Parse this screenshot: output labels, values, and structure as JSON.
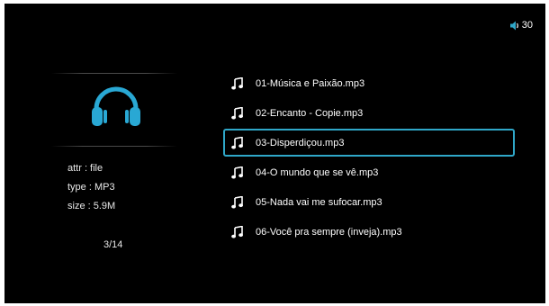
{
  "volume": {
    "icon": "speaker-icon",
    "level": "30"
  },
  "info": {
    "icon": "headphones-icon",
    "accent_color": "#29a8d4",
    "attr": "attr : file",
    "type": "type : MP3",
    "size": "size : 5.9M"
  },
  "page_indicator": "3/14",
  "playlist": {
    "selection_color": "#2fa7c8",
    "items": [
      {
        "icon": "music-note-icon",
        "label": "01-Música e Paixão.mp3"
      },
      {
        "icon": "music-note-icon",
        "label": "02-Encanto - Copie.mp3"
      },
      {
        "icon": "music-note-icon",
        "label": "03-Disperdiçou.mp3",
        "selected": true
      },
      {
        "icon": "music-note-icon",
        "label": "04-O mundo que se vê.mp3"
      },
      {
        "icon": "music-note-icon",
        "label": "05-Nada vai me sufocar.mp3"
      },
      {
        "icon": "music-note-icon",
        "label": "06-Você pra sempre (inveja).mp3"
      }
    ]
  }
}
